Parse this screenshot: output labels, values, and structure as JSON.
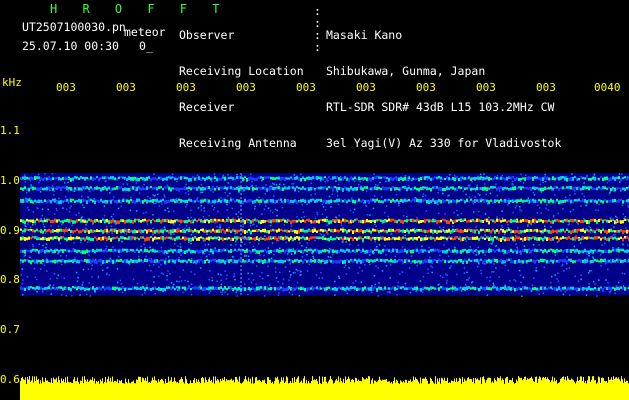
{
  "header": {
    "program": "H R O F F T",
    "filename": "UT2507100030.pn",
    "tag": "meteor",
    "timestamp": "25.07.10 00:30",
    "count": "0_",
    "meta": [
      {
        "label": "Observer",
        "value": "Masaki Kano"
      },
      {
        "label": "Receiving Location",
        "value": "Shibukawa, Gunma, Japan"
      },
      {
        "label": "Receiver",
        "value": "RTL-SDR SDR# 43dB L15 103.2MHz CW"
      },
      {
        "label": "Receiving Antenna",
        "value": "3el Yagi(V) Az 330 for Vladivostok"
      }
    ]
  },
  "chart_data": {
    "type": "heatmap",
    "y_unit_label": "kHz",
    "x_tick_labels": [
      "003",
      "003",
      "003",
      "003",
      "003",
      "003",
      "003",
      "003",
      "003",
      "0040"
    ],
    "y_tick_labels": [
      "1.1",
      "1.0",
      "0.9",
      "0.8",
      "0.7",
      "0.6"
    ],
    "ylim": [
      0.6,
      1.2
    ],
    "bands_khz": [
      1.01,
      0.99,
      0.965,
      0.925,
      0.905,
      0.89,
      0.865,
      0.845,
      0.79
    ],
    "colors": {
      "background": "#000000",
      "spectrum": "#00008b",
      "noise_bar": "#ffff00",
      "label": "#ffff00"
    }
  }
}
